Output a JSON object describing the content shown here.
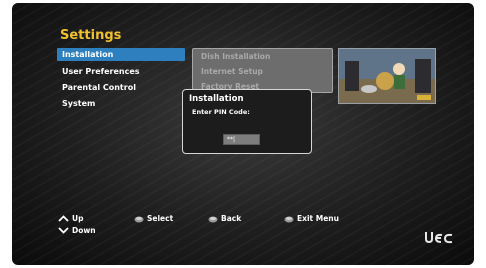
{
  "settings": {
    "title": "Settings",
    "menu": [
      {
        "label": "Installation",
        "selected": true
      },
      {
        "label": "User Preferences",
        "selected": false
      },
      {
        "label": "Parental Control",
        "selected": false
      },
      {
        "label": "System",
        "selected": false
      }
    ]
  },
  "submenu": {
    "items": [
      "Dish Installation",
      "Internet Setup",
      "Factory Reset"
    ]
  },
  "dialog": {
    "title": "Installation",
    "prompt": "Enter PIN Code:",
    "pin_value": "**|"
  },
  "footer": {
    "up_label": "Up",
    "down_label": "Down",
    "select_label": "Select",
    "back_label": "Back",
    "exit_label": "Exit Menu"
  },
  "colors": {
    "accent_title": "#f0c030",
    "selected_item": "#2e7fbd"
  },
  "icons": {
    "up": "chevron-up-icon",
    "down": "chevron-down-icon",
    "select": "ok-button-icon",
    "back": "back-button-icon",
    "exit": "exit-button-icon",
    "brand": "uec-logo"
  }
}
